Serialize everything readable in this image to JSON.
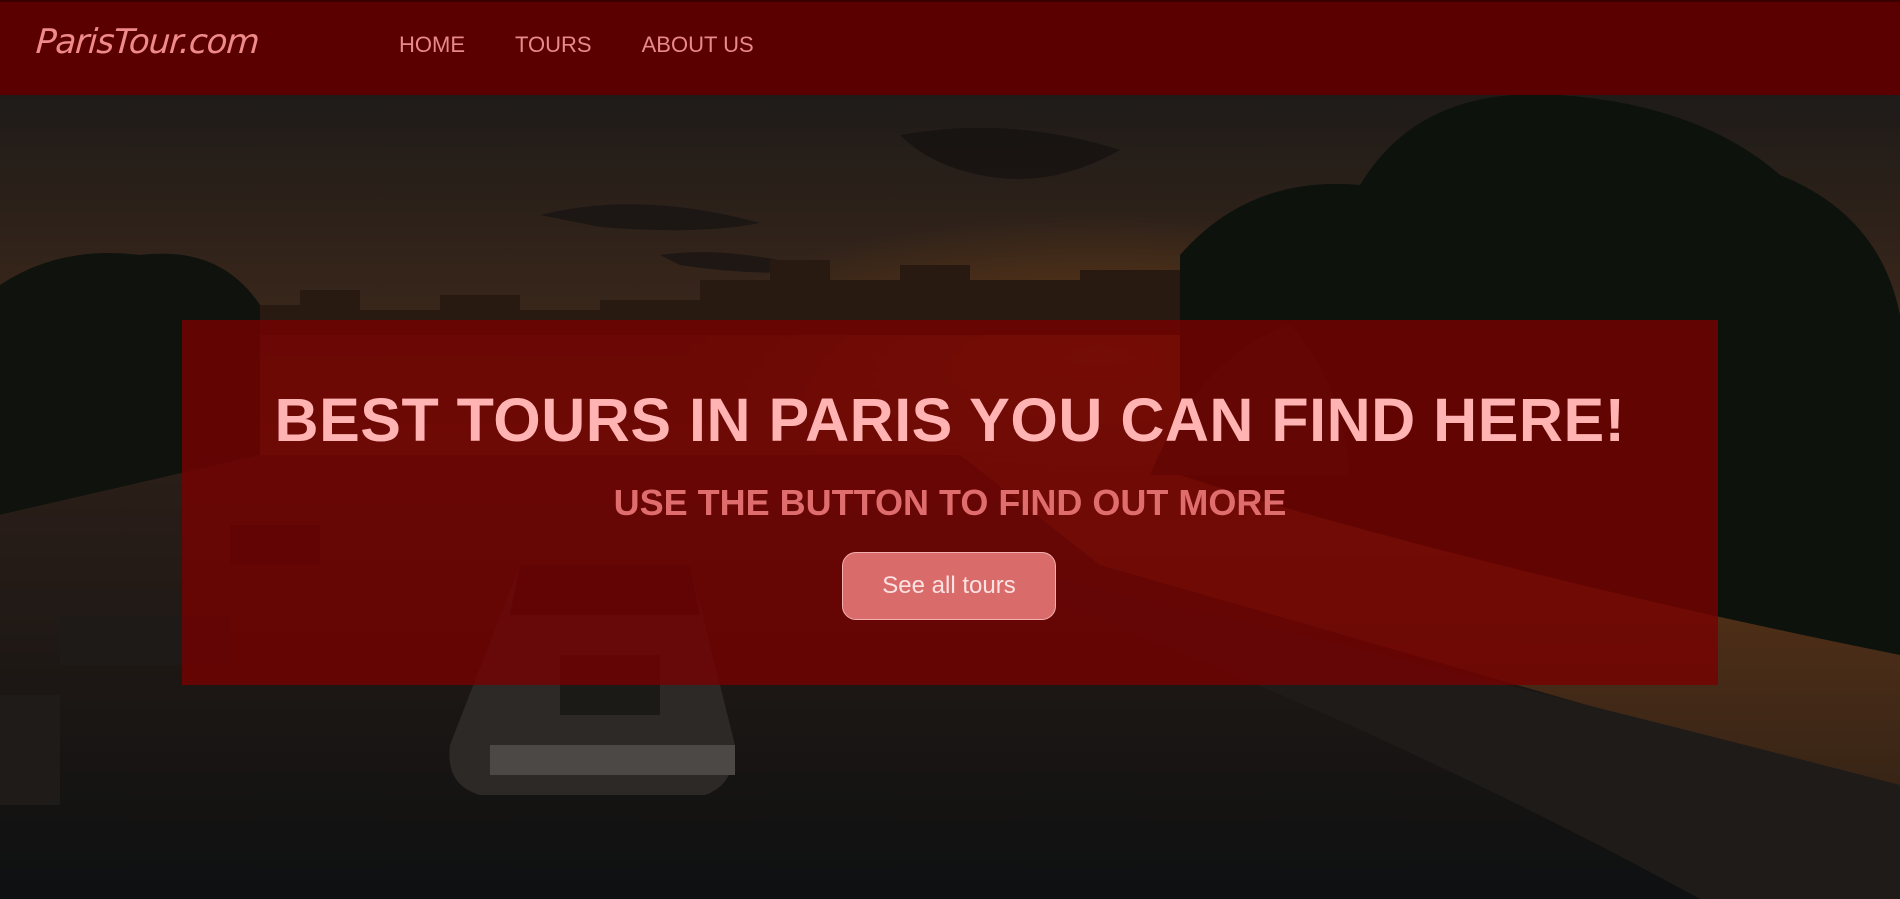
{
  "nav": {
    "brand": "ParisTour.com",
    "links": [
      "HOME",
      "TOURS",
      "ABOUT US"
    ]
  },
  "hero": {
    "title": "BEST TOURS IN PARIS YOU CAN FIND HERE!",
    "subtitle": "USE THE BUTTON TO FIND OUT MORE",
    "button_label": "See all tours"
  },
  "colors": {
    "navbar": "#5a0000",
    "brand": "#f08a8a",
    "nav_link": "#e8898a",
    "overlay_box": "#780000",
    "title": "#ffb3b3",
    "subtitle": "#e06d6d",
    "button": "#d96b6b"
  }
}
